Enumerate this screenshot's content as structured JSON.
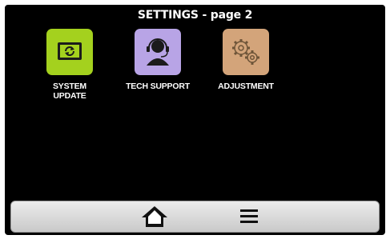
{
  "header": {
    "title": "SETTINGS - page 2"
  },
  "tiles": [
    {
      "line1": "SYSTEM",
      "line2": "UPDATE",
      "icon": "system-update-icon",
      "color": "#a4d11e"
    },
    {
      "line1": "TECH SUPPORT",
      "line2": "",
      "icon": "headset-icon",
      "color": "#b8a4e6"
    },
    {
      "line1": "ADJUSTMENT",
      "line2": "",
      "icon": "gears-icon",
      "color": "#d3a47a"
    }
  ],
  "bottom_bar": {
    "home_icon": "home-icon",
    "menu_icon": "menu-icon"
  }
}
